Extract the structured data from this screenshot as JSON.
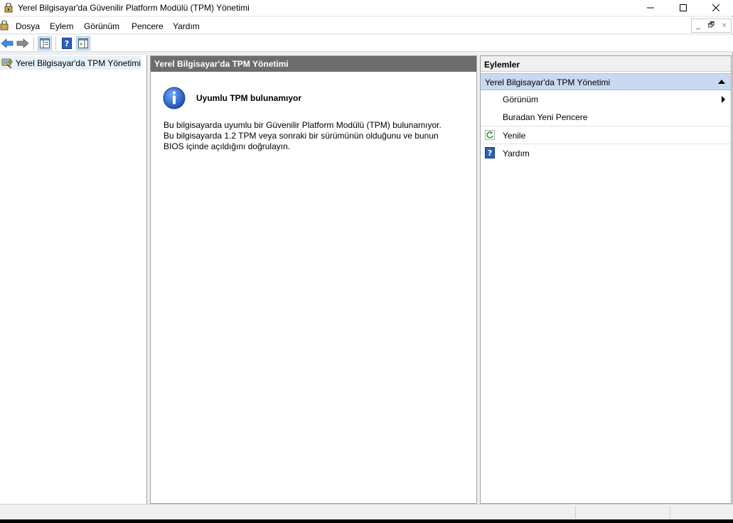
{
  "window": {
    "title": "Yerel Bilgisayar'da Güvenilir Platform Modülü (TPM) Yönetimi"
  },
  "menu": {
    "items": [
      "Dosya",
      "Eylem",
      "Görünüm",
      "Pencere",
      "Yardım"
    ]
  },
  "tree": {
    "root_label": "Yerel Bilgisayar'da TPM Yönetimi"
  },
  "main": {
    "header": "Yerel Bilgisayar'da TPM Yönetimi",
    "info_title": "Uyumlu TPM bulunamıyor",
    "info_lines": [
      "Bu bilgisayarda uyumlu bir Güvenilir Platform Modülü (TPM) bulunamıyor.",
      "Bu bilgisayarda 1.2 TPM veya sonraki bir sürümünün olduğunu ve bunun",
      "BIOS içinde açıldığını doğrulayın."
    ]
  },
  "actions": {
    "header": "Eylemler",
    "section": "Yerel Bilgisayar'da TPM Yönetimi",
    "items": [
      "Görünüm",
      "Buradan Yeni Pencere",
      "Yenile",
      "Yardım"
    ]
  },
  "colors": {
    "header_bg": "#6d6d6d",
    "section_bg": "#c9daf0",
    "selected_bg": "#e5f1fb",
    "info_blue": "#1f5fbf"
  }
}
